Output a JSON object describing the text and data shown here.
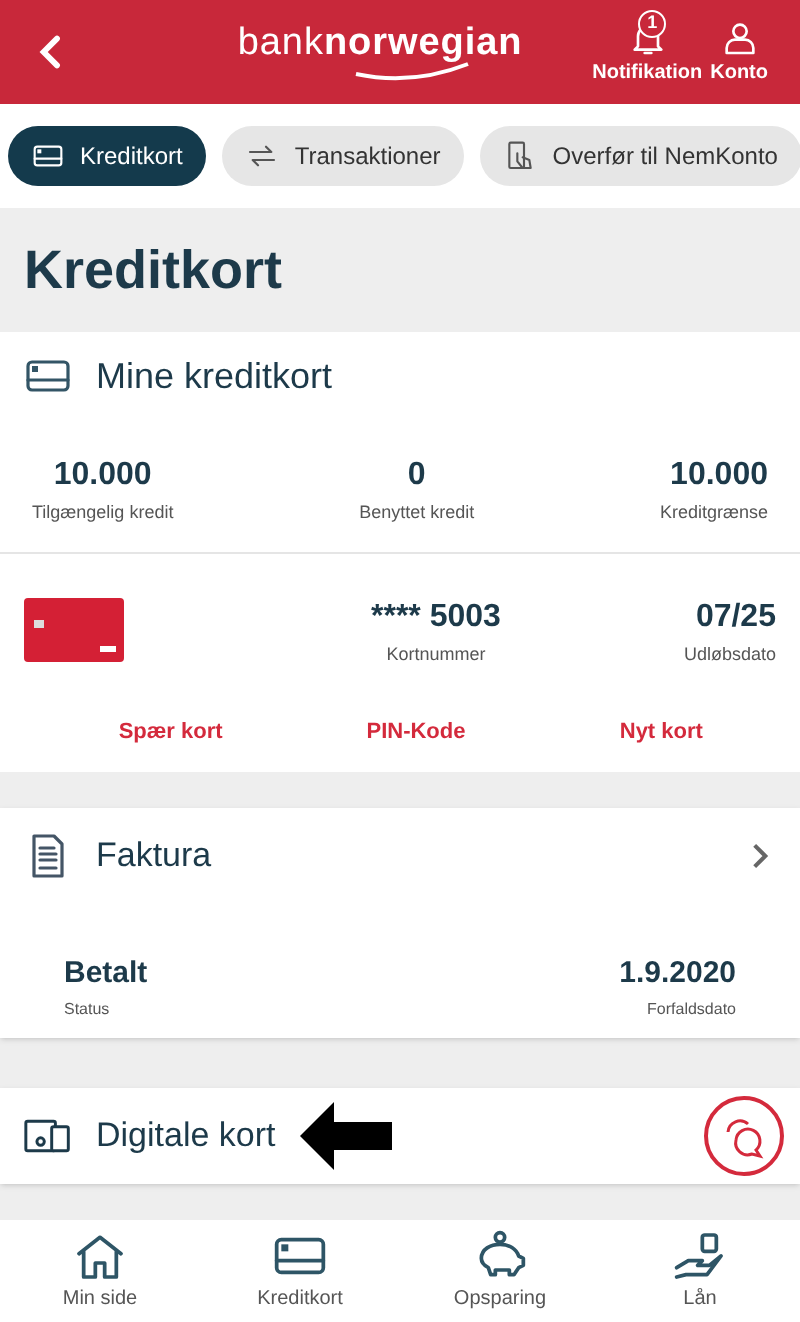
{
  "header": {
    "logo": {
      "light": "bank",
      "bold": "norwegian"
    },
    "notification_badge": "1",
    "actions": [
      {
        "kind": "bell",
        "label": "Notifikation"
      },
      {
        "kind": "user",
        "label": "Konto"
      }
    ]
  },
  "tabs": [
    {
      "kind": "card",
      "label": "Kreditkort",
      "selected": true
    },
    {
      "kind": "transfer",
      "label": "Transaktioner",
      "selected": false
    },
    {
      "kind": "phone",
      "label": "Overfør til NemKonto",
      "selected": false
    }
  ],
  "page_title": "Kreditkort",
  "credit_cards": {
    "title": "Mine kreditkort",
    "stats": [
      {
        "value": "10.000",
        "label": "Tilgængelig kredit"
      },
      {
        "value": "0",
        "label": "Benyttet kredit"
      },
      {
        "value": "10.000",
        "label": "Kreditgrænse"
      }
    ],
    "card": {
      "number": "**** 5003",
      "number_label": "Kortnummer",
      "expiry": "07/25",
      "expiry_label": "Udløbsdato"
    },
    "actions": [
      "Spær kort",
      "PIN-Kode",
      "Nyt kort"
    ]
  },
  "invoice": {
    "title": "Faktura",
    "status": "Betalt",
    "status_label": "Status",
    "due_date": "1.9.2020",
    "due_label": "Forfaldsdato"
  },
  "digital_cards": {
    "title": "Digitale kort"
  },
  "bottom_nav": [
    {
      "kind": "house",
      "label": "Min side"
    },
    {
      "kind": "card",
      "label": "Kreditkort"
    },
    {
      "kind": "piggy",
      "label": "Opsparing"
    },
    {
      "kind": "hand",
      "label": "Lån"
    }
  ]
}
